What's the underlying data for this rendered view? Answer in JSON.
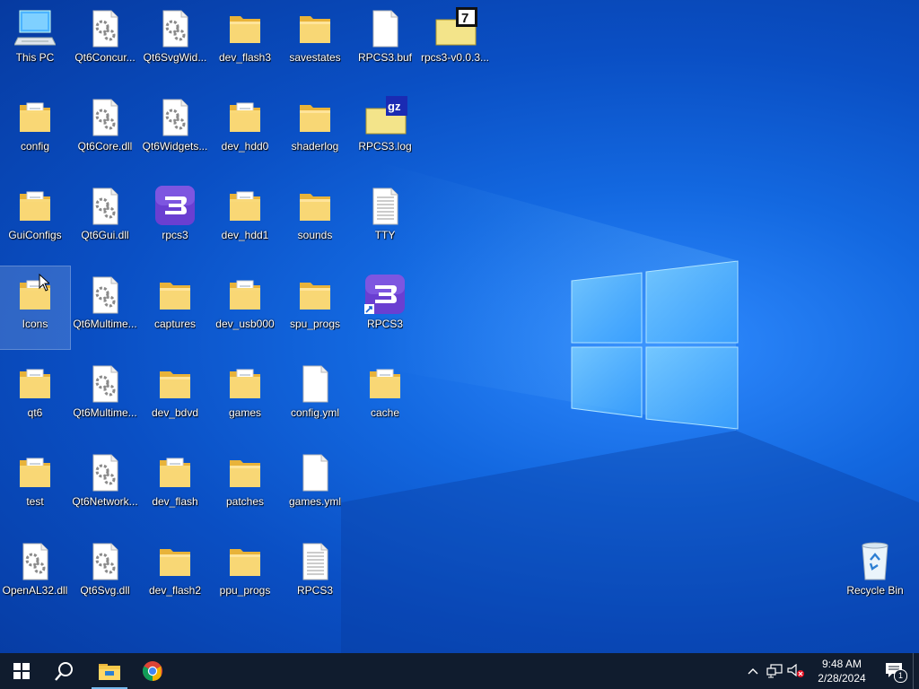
{
  "desktop": {
    "icons": [
      {
        "label": "This PC",
        "type": "pc"
      },
      {
        "label": "Qt6Concur...",
        "type": "dll"
      },
      {
        "label": "Qt6SvgWid...",
        "type": "dll"
      },
      {
        "label": "dev_flash3",
        "type": "folder"
      },
      {
        "label": "savestates",
        "type": "folder"
      },
      {
        "label": "RPCS3.buf",
        "type": "file"
      },
      {
        "label": "rpcs3-v0.0.3...",
        "type": "archive7z"
      },
      {
        "label": "config",
        "type": "folderdoc"
      },
      {
        "label": "Qt6Core.dll",
        "type": "dll"
      },
      {
        "label": "Qt6Widgets...",
        "type": "dll"
      },
      {
        "label": "dev_hdd0",
        "type": "folderdoc"
      },
      {
        "label": "shaderlog",
        "type": "folder"
      },
      {
        "label": "RPCS3.log",
        "type": "archivegz"
      },
      {
        "label": "GuiConfigs",
        "type": "folderdoc"
      },
      {
        "label": "Qt6Gui.dll",
        "type": "dll"
      },
      {
        "label": "rpcs3",
        "type": "rpcs3"
      },
      {
        "label": "dev_hdd1",
        "type": "folderdoc"
      },
      {
        "label": "sounds",
        "type": "folder"
      },
      {
        "label": "TTY",
        "type": "text"
      },
      {
        "label": "Icons",
        "type": "folderdoc",
        "selected": true
      },
      {
        "label": "Qt6Multime...",
        "type": "dll"
      },
      {
        "label": "captures",
        "type": "folder"
      },
      {
        "label": "dev_usb000",
        "type": "folderdoc"
      },
      {
        "label": "spu_progs",
        "type": "folder"
      },
      {
        "label": "RPCS3",
        "type": "rpcs3shortcut"
      },
      {
        "label": "qt6",
        "type": "folderdoc"
      },
      {
        "label": "Qt6Multime...",
        "type": "dll"
      },
      {
        "label": "dev_bdvd",
        "type": "folder"
      },
      {
        "label": "games",
        "type": "folderdoc"
      },
      {
        "label": "config.yml",
        "type": "file"
      },
      {
        "label": "cache",
        "type": "folderdoc"
      },
      {
        "label": "test",
        "type": "folderdoc"
      },
      {
        "label": "Qt6Network...",
        "type": "dll"
      },
      {
        "label": "dev_flash",
        "type": "folderdoc"
      },
      {
        "label": "patches",
        "type": "folder"
      },
      {
        "label": "games.yml",
        "type": "file"
      },
      {
        "label": "OpenAL32.dll",
        "type": "dll"
      },
      {
        "label": "Qt6Svg.dll",
        "type": "dll"
      },
      {
        "label": "dev_flash2",
        "type": "folder"
      },
      {
        "label": "ppu_progs",
        "type": "folder"
      },
      {
        "label": "RPCS3",
        "type": "text"
      },
      {
        "label": "Recycle Bin",
        "type": "recycle"
      }
    ]
  },
  "taskbar": {
    "start_icon": "windows-start-icon",
    "search_icon": "search-icon",
    "apps": [
      {
        "name": "file-explorer-icon",
        "active": true
      },
      {
        "name": "chrome-icon",
        "active": false
      }
    ],
    "clock_time": "9:48 AM",
    "clock_date": "2/28/2024",
    "notification_count": "1"
  },
  "colors": {
    "taskbar": "#101c2e",
    "accent": "#76b9ed",
    "folder": "#f8d775"
  }
}
